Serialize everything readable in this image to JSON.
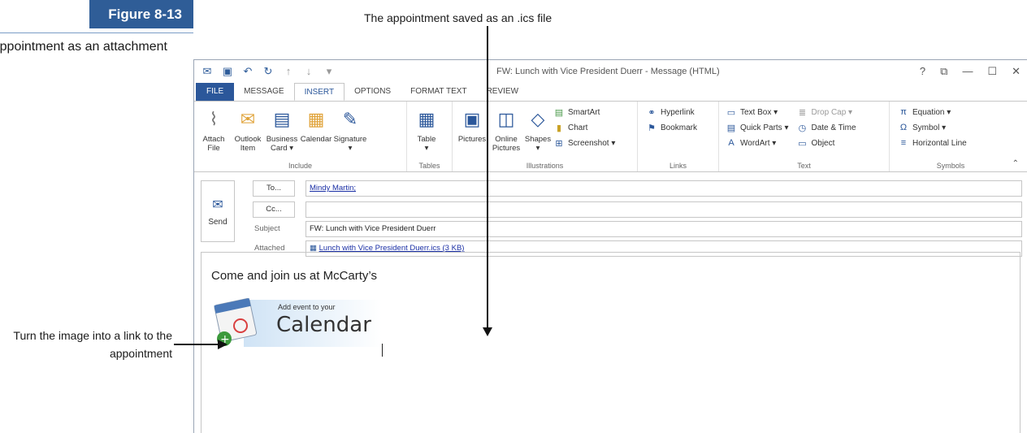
{
  "figure": {
    "label": "Figure 8-13",
    "caption": "appointment as an attachment"
  },
  "callouts": {
    "top": "The appointment saved as an .ics file",
    "left": "Turn the image into a link to the appointment"
  },
  "window": {
    "title": "FW: Lunch with Vice President Duerr - Message (HTML)",
    "controls": [
      "?",
      "⧉",
      "—",
      "☐",
      "✕"
    ]
  },
  "tabs": [
    "FILE",
    "MESSAGE",
    "INSERT",
    "OPTIONS",
    "FORMAT TEXT",
    "REVIEW"
  ],
  "ribbon": {
    "include": {
      "label": "Include",
      "buttons": [
        {
          "l1": "Attach",
          "l2": "File"
        },
        {
          "l1": "Outlook",
          "l2": "Item"
        },
        {
          "l1": "Business",
          "l2": "Card ▾"
        },
        {
          "l1": "Calendar",
          "l2": ""
        },
        {
          "l1": "Signature",
          "l2": "▾"
        }
      ]
    },
    "tables": {
      "label": "Tables",
      "buttons": [
        {
          "l1": "Table",
          "l2": "▾"
        }
      ]
    },
    "illustrations": {
      "label": "Illustrations",
      "buttons": [
        {
          "l1": "Pictures",
          "l2": ""
        },
        {
          "l1": "Online",
          "l2": "Pictures"
        },
        {
          "l1": "Shapes",
          "l2": "▾"
        }
      ],
      "small": [
        "SmartArt",
        "Chart",
        "Screenshot ▾"
      ]
    },
    "links": {
      "label": "Links",
      "small": [
        "Hyperlink",
        "Bookmark"
      ]
    },
    "text": {
      "label": "Text",
      "col1": [
        "Text Box ▾",
        "Quick Parts ▾",
        "WordArt ▾"
      ],
      "col2": [
        "Drop Cap ▾",
        "Date & Time",
        "Object"
      ]
    },
    "symbols": {
      "label": "Symbols",
      "small": [
        "Equation ▾",
        "Symbol ▾",
        "Horizontal Line"
      ]
    }
  },
  "message": {
    "send_label": "Send",
    "to_button": "To...",
    "cc_button": "Cc...",
    "subject_label": "Subject",
    "attached_label": "Attached",
    "to_value": "Mindy Martin;",
    "cc_value": "",
    "subject_value": "FW: Lunch with Vice President Duerr",
    "attachment": "Lunch with Vice President Duerr.ics (3 KB)"
  },
  "body": {
    "text": "Come and join us at McCarty’s",
    "image_small": "Add event to your",
    "image_big": "Calendar"
  },
  "colors": {
    "accent": "#2b579a",
    "figure_tab": "#2f5d97"
  }
}
